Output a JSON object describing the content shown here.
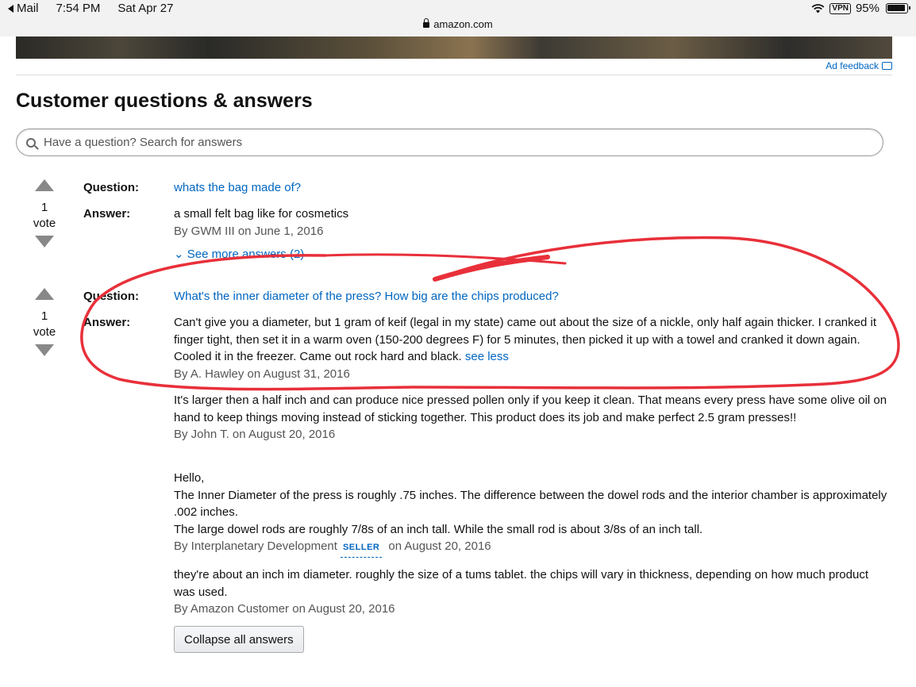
{
  "status_bar": {
    "back_app": "Mail",
    "time": "7:54 PM",
    "date": "Sat Apr 27",
    "vpn": "VPN",
    "battery": "95%"
  },
  "browser": {
    "url": "amazon.com"
  },
  "ad": {
    "feedback": "Ad feedback"
  },
  "section": {
    "title": "Customer questions & answers"
  },
  "search": {
    "placeholder": "Have a question? Search for answers"
  },
  "labels": {
    "question": "Question:",
    "answer": "Answer:",
    "vote": "vote",
    "seller": "SELLER"
  },
  "questions": [
    {
      "votes": "1",
      "question": "whats the bag made of?",
      "answer": "a small felt bag like for cosmetics",
      "by": "By GWM III on June 1, 2016",
      "see_more": "See more answers (2)"
    },
    {
      "votes": "1",
      "question": "What's the inner diameter of the press? How big are the chips produced?",
      "answer": "Can't give you a diameter, but 1 gram of keif (legal in my state) came out about the size of a nickle, only half again thicker. I cranked it finger tight, then set it in a warm oven (150-200 degrees F) for 5 minutes, then picked it up with a towel and cranked it down again. Cooled it in the freezer. Came out rock hard and black.",
      "see_less": "see less",
      "by": "By A. Hawley on August 31, 2016",
      "more_answers": [
        {
          "text": "It's larger then a half inch and can produce nice pressed pollen only if you keep it clean. That means every press have some olive oil on hand to keep things moving instead of sticking together. This product does its job and make perfect 2.5 gram presses!!",
          "by": "By John T. on August 20, 2016"
        },
        {
          "line1": "Hello,",
          "line2": "The Inner Diameter of the press is roughly .75 inches. The difference between the dowel rods and the interior chamber is approximately .002 inches.",
          "line3": "The large dowel rods are roughly 7/8s of an inch tall. While the small rod is about 3/8s of an inch tall.",
          "by_name": "By Interplanetary Development",
          "by_date": "on August 20, 2016"
        },
        {
          "text": "they're about an inch im diameter. roughly the size of a tums tablet. the chips will vary in thickness, depending on how much product was used.",
          "by": "By Amazon Customer on August 20, 2016"
        }
      ]
    }
  ],
  "collapse": {
    "label": "Collapse all answers"
  },
  "colors": {
    "link": "#0066c0",
    "annotation": "#e8303a"
  }
}
